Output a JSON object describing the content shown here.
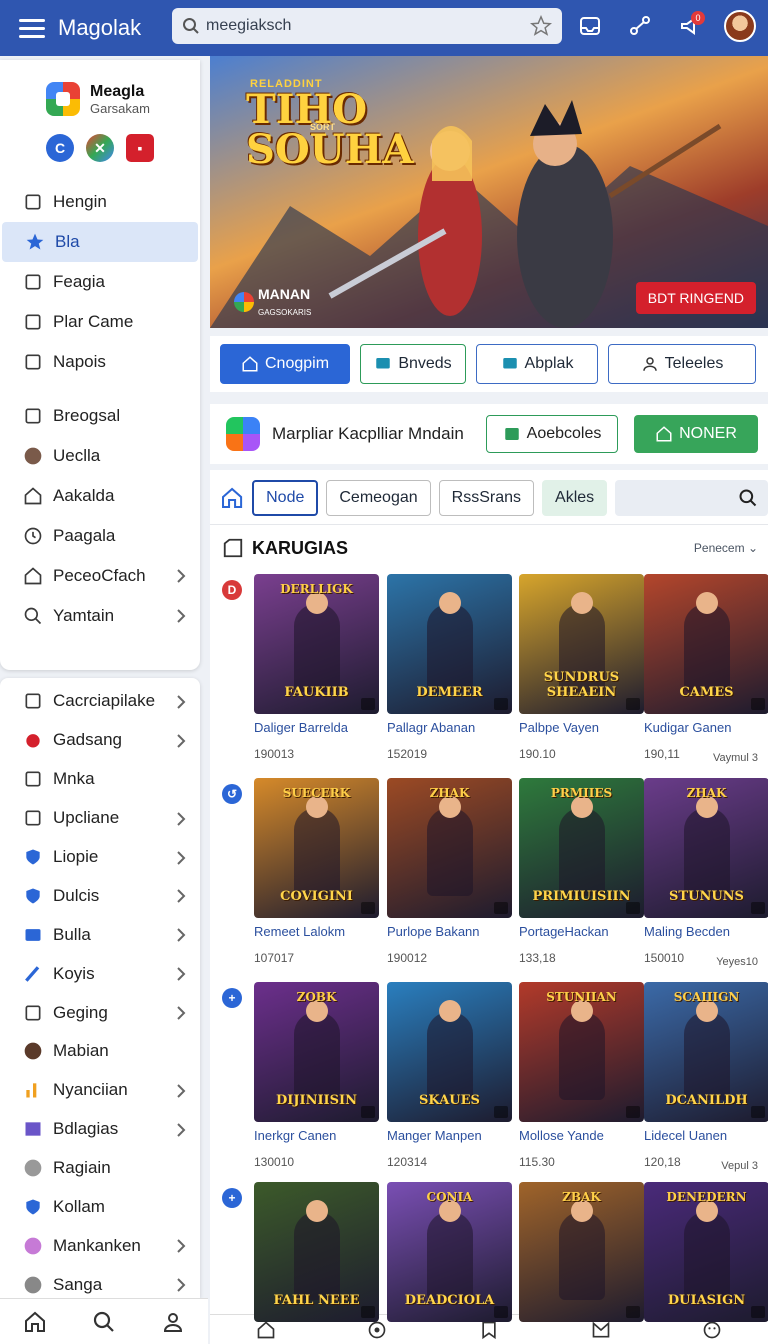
{
  "header": {
    "app_title": "Magolak",
    "search_value": "meegiaksch",
    "notification_count": "0"
  },
  "sidebar": {
    "account_name": "Meagla",
    "account_sub": "Garsakam",
    "primary_items": [
      {
        "label": "Hengin",
        "icon": "share-icon"
      },
      {
        "label": "Bla",
        "icon": "star-icon",
        "active": true
      },
      {
        "label": "Feagia",
        "icon": "grid-icon"
      },
      {
        "label": "Plar Came",
        "icon": "square-icon"
      },
      {
        "label": "Napois",
        "icon": "chart-icon"
      },
      {
        "label": "Breogsal",
        "icon": "bag-icon"
      },
      {
        "label": "Ueclla",
        "icon": "avatar-icon"
      },
      {
        "label": "Aakalda",
        "icon": "home-icon"
      },
      {
        "label": "Paagala",
        "icon": "clock-icon"
      },
      {
        "label": "PeceoCfach",
        "icon": "home-outline-icon",
        "chevron": true
      },
      {
        "label": "Yamtain",
        "icon": "search-icon",
        "chevron": true
      }
    ],
    "secondary_items": [
      {
        "label": "Cacrciapilake",
        "icon": "inbox-icon",
        "chevron": true
      },
      {
        "label": "Gadsang",
        "icon": "apple-icon",
        "chevron": true
      },
      {
        "label": "Mnka",
        "icon": "square-icon",
        "chevron": false
      },
      {
        "label": "Upcliane",
        "icon": "square-icon",
        "chevron": true
      },
      {
        "label": "Liopie",
        "icon": "shield-icon",
        "chevron": true
      },
      {
        "label": "Dulcis",
        "icon": "shield-icon",
        "chevron": true
      },
      {
        "label": "Bulla",
        "icon": "card-icon",
        "chevron": true
      },
      {
        "label": "Koyis",
        "icon": "brush-icon",
        "chevron": true
      },
      {
        "label": "Geging",
        "icon": "calendar-icon",
        "chevron": true
      },
      {
        "label": "Mabian",
        "icon": "person-icon",
        "chevron": false
      },
      {
        "label": "Nyanciian",
        "icon": "music-icon",
        "chevron": true
      },
      {
        "label": "Bdlagias",
        "icon": "photo-icon",
        "chevron": true
      },
      {
        "label": "Ragiain",
        "icon": "mail-icon",
        "chevron": false
      },
      {
        "label": "Kollam",
        "icon": "shield-icon",
        "chevron": false
      },
      {
        "label": "Mankanken",
        "icon": "paw-icon",
        "chevron": true
      },
      {
        "label": "Sanga",
        "icon": "ball-icon",
        "chevron": true
      }
    ]
  },
  "hero": {
    "kicker": "RELADDINT",
    "title_line1": "TIHO",
    "title_line2": "SOUHA",
    "title_small": "SORT",
    "brand": "MANAN",
    "brand_sub": "GAGSOKARIS",
    "cta": "BDT RINGEND"
  },
  "actions": [
    "Cnogpim",
    "Bnveds",
    "Abplak",
    "Teleeles"
  ],
  "promo": {
    "text": "Marpliar Kacplliar Mndain",
    "btn1": "Aoebcoles",
    "btn2": "NONER"
  },
  "filters": [
    "Node",
    "Cemeogan",
    "RssSrans",
    "Akles"
  ],
  "section": {
    "title": "KARUGIAS",
    "sort": "Penecem"
  },
  "rows": [
    {
      "badge": "D",
      "badge_color": "#d83a3a",
      "extra": "",
      "cards": [
        {
          "art_top": "DERLLIGK",
          "art_title": "FAUKIIB",
          "title": "Daliger Barrelda",
          "meta": "190013",
          "bg": "#7a3f8f"
        },
        {
          "art_top": "",
          "art_title": "DEMEER",
          "title": "Pallagr Abanan",
          "meta": "152019",
          "bg": "#2c74a8"
        },
        {
          "art_top": "",
          "art_title": "SUNDRUS SHEAEIN",
          "title": "Palbpe Vayen",
          "meta": "190.10",
          "bg": "#d7a52c"
        },
        {
          "art_top": "",
          "art_title": "CAMES",
          "title": "Kudigar Ganen",
          "meta": "190,11",
          "bg": "#b4462c"
        }
      ],
      "tail": "Vaymul 3"
    },
    {
      "badge": "↺",
      "badge_color": "#2b66d6",
      "cards": [
        {
          "art_top": "SUECERK",
          "art_title": "COVIGINI",
          "title": "Remeet Lalokm",
          "meta": "107017",
          "bg": "#d68a2a"
        },
        {
          "art_top": "ZHAK",
          "art_title": "",
          "title": "Purlope Bakann",
          "meta": "190012",
          "bg": "#9c4a24"
        },
        {
          "art_top": "PRMIIES",
          "art_title": "PRIMIUISIIN",
          "title": "PortageHackan",
          "meta": "133,18",
          "bg": "#2e7a3c"
        },
        {
          "art_top": "ZHAK",
          "art_title": "STUNUNS",
          "title": "Maling Becden",
          "meta": "150010",
          "bg": "#6a3c8a"
        }
      ],
      "tail": "Yeyes10"
    },
    {
      "badge": "+",
      "badge_color": "#2b66d6",
      "cards": [
        {
          "art_top": "ZOBK",
          "art_title": "DIJINIISIN",
          "title": "Inerkgr Canen",
          "meta": "130010",
          "bg": "#6c2f8c"
        },
        {
          "art_top": "",
          "art_title": "SKAUES",
          "title": "Manger Manpen",
          "meta": "120314",
          "bg": "#2a7fbf"
        },
        {
          "art_top": "STUNIIAN",
          "art_title": "",
          "title": "Mollose Yande",
          "meta": "115.30",
          "bg": "#b23a2a"
        },
        {
          "art_top": "SCAIIIGN",
          "art_title": "DCANILDH",
          "title": "Lidecel Uanen",
          "meta": "120,18",
          "bg": "#3b6aa8"
        }
      ],
      "tail": "Vepul 3"
    },
    {
      "badge": "+",
      "badge_color": "#2b66d6",
      "cards": [
        {
          "art_top": "",
          "art_title": "FAHL NEEE",
          "title": "",
          "meta": "",
          "bg": "#3c5a2a"
        },
        {
          "art_top": "CONIA",
          "art_title": "DEADCIOLA",
          "title": "",
          "meta": "",
          "bg": "#7a4fb4"
        },
        {
          "art_top": "ZBAK",
          "art_title": "",
          "title": "",
          "meta": "",
          "bg": "#a0642a"
        },
        {
          "art_top": "DENEDERN",
          "art_title": "DUIASIGN",
          "title": "",
          "meta": "",
          "bg": "#4a2a7a"
        }
      ],
      "tail": ""
    }
  ],
  "colors": {
    "header": "#2f56b0",
    "accent": "#2b66d6",
    "green": "#2d9b59",
    "red": "#d4202c"
  }
}
